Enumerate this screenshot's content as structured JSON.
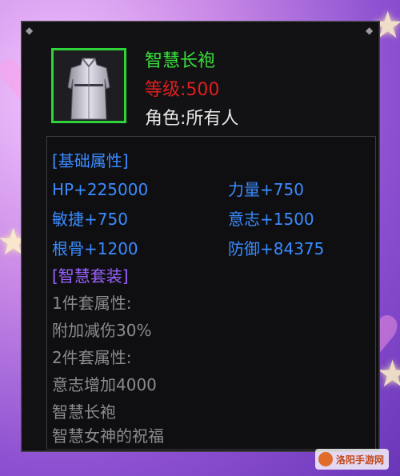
{
  "item": {
    "name": "智慧长袍",
    "level": "等级:500",
    "role": "角色:所有人",
    "icon": "robe-icon"
  },
  "stats": {
    "base_header": "[基础属性]",
    "hp": "HP+225000",
    "strength": "力量+750",
    "agility": "敏捷+750",
    "will": "意志+1500",
    "bone": "根骨+1200",
    "defense": "防御+84375",
    "set_header": "[智慧套装]",
    "set_piece1": "1件套属性:",
    "set_bonus1": "附加减伤30%",
    "set_piece2": "2件套属性:",
    "set_bonus2": "意志增加4000",
    "set_member1": "智慧长袍",
    "set_member2": "智慧女神的祝福"
  },
  "watermark": {
    "text": "洛阳手游网"
  },
  "colors": {
    "name_green": "#38e03c",
    "level_red": "#e01e1e",
    "stat_blue": "#3a8bff",
    "set_purple": "#9a62ff",
    "inactive_grey": "#8a8a90"
  }
}
